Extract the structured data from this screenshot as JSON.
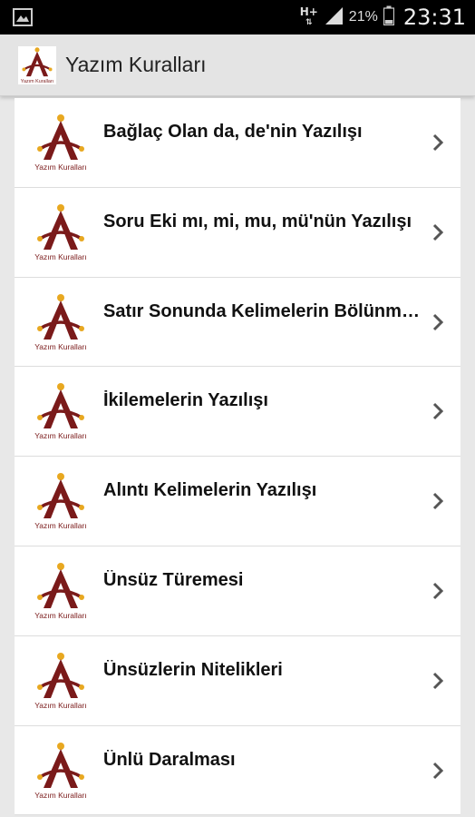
{
  "status_bar": {
    "network": "H+",
    "battery_percent": "21%",
    "time": "23:31",
    "icons": [
      "gallery-icon",
      "network-arrows-icon",
      "signal-icon",
      "battery-icon"
    ]
  },
  "app_bar": {
    "title": "Yazım Kuralları",
    "logo_text": "Yazım Kuralları"
  },
  "list": {
    "items": [
      {
        "label": "Bağlaç Olan da, de'nin Yazılışı"
      },
      {
        "label": "Soru Eki mı, mi, mu, mü'nün Yazılışı"
      },
      {
        "label": "Satır Sonunda Kelimelerin Bölünmesi"
      },
      {
        "label": "İkilemelerin Yazılışı"
      },
      {
        "label": "Alıntı Kelimelerin Yazılışı"
      },
      {
        "label": "Ünsüz Türemesi"
      },
      {
        "label": "Ünsüzlerin Nitelikleri"
      },
      {
        "label": "Ünlü Daralması"
      }
    ]
  },
  "colors": {
    "logo_maroon": "#7a1a1a",
    "logo_gold": "#e8a820",
    "app_bar_bg": "#e4e4e4",
    "status_bar_bg": "#000000",
    "page_bg": "#e8e8e8"
  }
}
